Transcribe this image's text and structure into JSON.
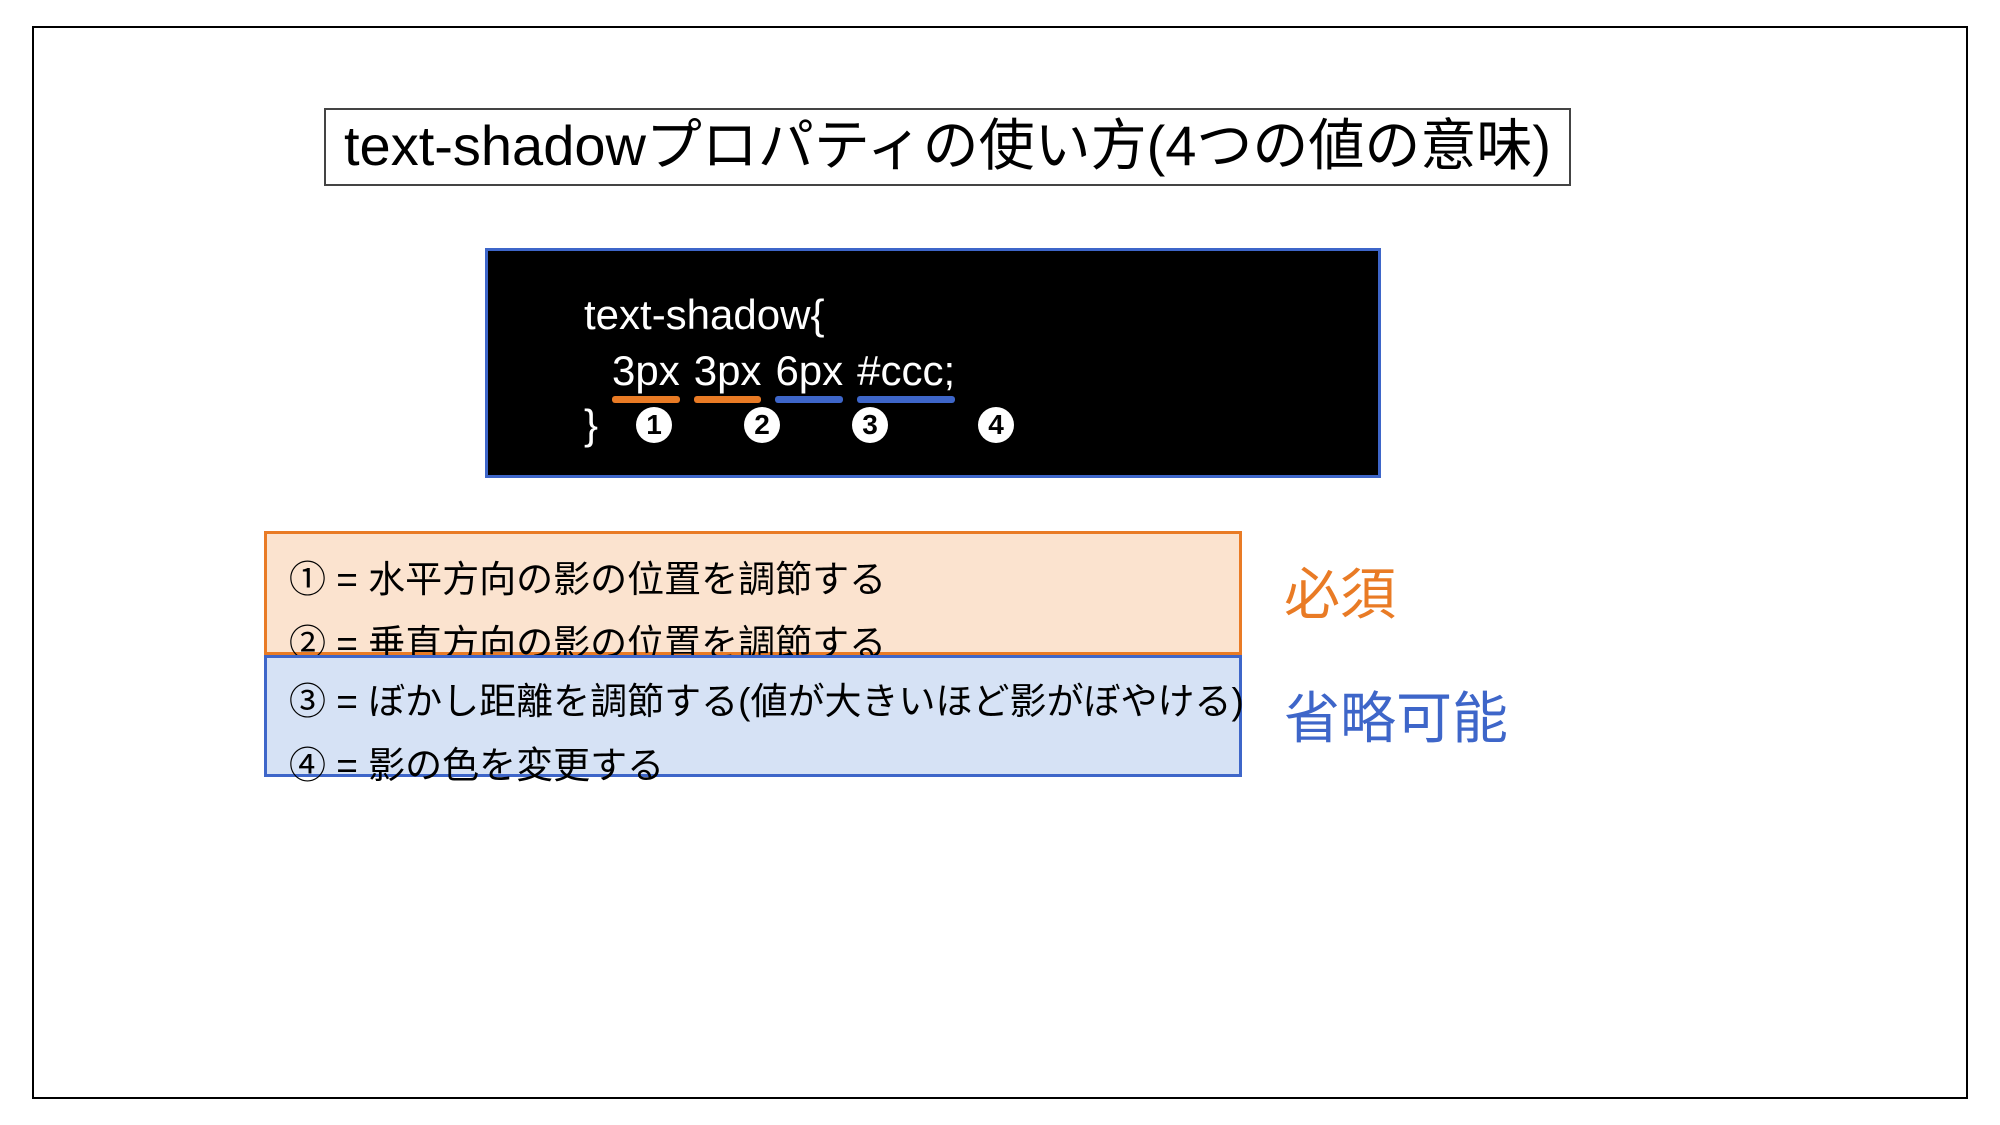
{
  "title": "text-shadowプロパティの使い方(4つの値の意味)",
  "code": {
    "declaration": "text-shadow{",
    "close_brace": "}",
    "values": {
      "v1": "3px",
      "v2": "3px",
      "v3": "6px",
      "v4": "#ccc;"
    },
    "markers": {
      "m1": "1",
      "m2": "2",
      "m3": "3",
      "m4": "4"
    }
  },
  "desc_required": {
    "line1": "① = 水平方向の影の位置を調節する",
    "line2": "② = 垂直方向の影の位置を調節する"
  },
  "desc_optional": {
    "line3": "③ = ぼかし距離を調節する(値が大きいほど影がぼやける)",
    "line4": "④ = 影の色を変更する"
  },
  "side": {
    "required": "必須",
    "optional": "省略可能"
  },
  "colors": {
    "orange": "#e97b25",
    "blue": "#3e66c9",
    "orange_fill": "#fbe3cf",
    "blue_fill": "#d6e2f5"
  }
}
